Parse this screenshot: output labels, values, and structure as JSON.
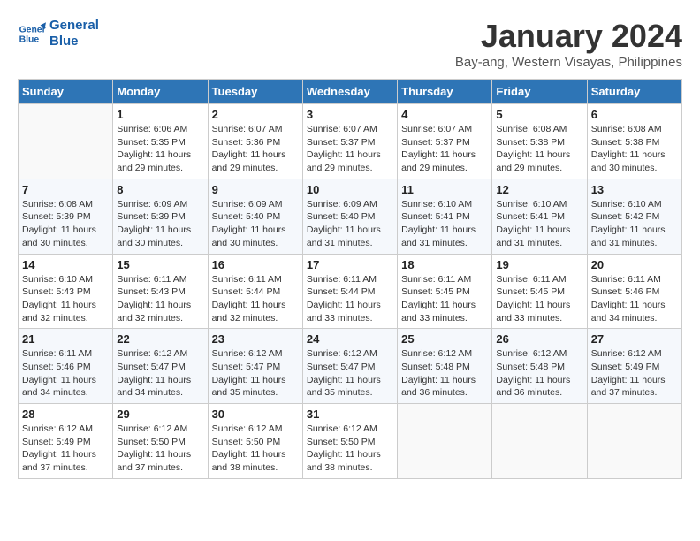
{
  "logo": {
    "line1": "General",
    "line2": "Blue"
  },
  "title": "January 2024",
  "location": "Bay-ang, Western Visayas, Philippines",
  "days_of_week": [
    "Sunday",
    "Monday",
    "Tuesday",
    "Wednesday",
    "Thursday",
    "Friday",
    "Saturday"
  ],
  "weeks": [
    [
      {
        "day": "",
        "info": ""
      },
      {
        "day": "1",
        "info": "Sunrise: 6:06 AM\nSunset: 5:35 PM\nDaylight: 11 hours\nand 29 minutes."
      },
      {
        "day": "2",
        "info": "Sunrise: 6:07 AM\nSunset: 5:36 PM\nDaylight: 11 hours\nand 29 minutes."
      },
      {
        "day": "3",
        "info": "Sunrise: 6:07 AM\nSunset: 5:37 PM\nDaylight: 11 hours\nand 29 minutes."
      },
      {
        "day": "4",
        "info": "Sunrise: 6:07 AM\nSunset: 5:37 PM\nDaylight: 11 hours\nand 29 minutes."
      },
      {
        "day": "5",
        "info": "Sunrise: 6:08 AM\nSunset: 5:38 PM\nDaylight: 11 hours\nand 29 minutes."
      },
      {
        "day": "6",
        "info": "Sunrise: 6:08 AM\nSunset: 5:38 PM\nDaylight: 11 hours\nand 30 minutes."
      }
    ],
    [
      {
        "day": "7",
        "info": "Sunrise: 6:08 AM\nSunset: 5:39 PM\nDaylight: 11 hours\nand 30 minutes."
      },
      {
        "day": "8",
        "info": "Sunrise: 6:09 AM\nSunset: 5:39 PM\nDaylight: 11 hours\nand 30 minutes."
      },
      {
        "day": "9",
        "info": "Sunrise: 6:09 AM\nSunset: 5:40 PM\nDaylight: 11 hours\nand 30 minutes."
      },
      {
        "day": "10",
        "info": "Sunrise: 6:09 AM\nSunset: 5:40 PM\nDaylight: 11 hours\nand 31 minutes."
      },
      {
        "day": "11",
        "info": "Sunrise: 6:10 AM\nSunset: 5:41 PM\nDaylight: 11 hours\nand 31 minutes."
      },
      {
        "day": "12",
        "info": "Sunrise: 6:10 AM\nSunset: 5:41 PM\nDaylight: 11 hours\nand 31 minutes."
      },
      {
        "day": "13",
        "info": "Sunrise: 6:10 AM\nSunset: 5:42 PM\nDaylight: 11 hours\nand 31 minutes."
      }
    ],
    [
      {
        "day": "14",
        "info": "Sunrise: 6:10 AM\nSunset: 5:43 PM\nDaylight: 11 hours\nand 32 minutes."
      },
      {
        "day": "15",
        "info": "Sunrise: 6:11 AM\nSunset: 5:43 PM\nDaylight: 11 hours\nand 32 minutes."
      },
      {
        "day": "16",
        "info": "Sunrise: 6:11 AM\nSunset: 5:44 PM\nDaylight: 11 hours\nand 32 minutes."
      },
      {
        "day": "17",
        "info": "Sunrise: 6:11 AM\nSunset: 5:44 PM\nDaylight: 11 hours\nand 33 minutes."
      },
      {
        "day": "18",
        "info": "Sunrise: 6:11 AM\nSunset: 5:45 PM\nDaylight: 11 hours\nand 33 minutes."
      },
      {
        "day": "19",
        "info": "Sunrise: 6:11 AM\nSunset: 5:45 PM\nDaylight: 11 hours\nand 33 minutes."
      },
      {
        "day": "20",
        "info": "Sunrise: 6:11 AM\nSunset: 5:46 PM\nDaylight: 11 hours\nand 34 minutes."
      }
    ],
    [
      {
        "day": "21",
        "info": "Sunrise: 6:11 AM\nSunset: 5:46 PM\nDaylight: 11 hours\nand 34 minutes."
      },
      {
        "day": "22",
        "info": "Sunrise: 6:12 AM\nSunset: 5:47 PM\nDaylight: 11 hours\nand 34 minutes."
      },
      {
        "day": "23",
        "info": "Sunrise: 6:12 AM\nSunset: 5:47 PM\nDaylight: 11 hours\nand 35 minutes."
      },
      {
        "day": "24",
        "info": "Sunrise: 6:12 AM\nSunset: 5:47 PM\nDaylight: 11 hours\nand 35 minutes."
      },
      {
        "day": "25",
        "info": "Sunrise: 6:12 AM\nSunset: 5:48 PM\nDaylight: 11 hours\nand 36 minutes."
      },
      {
        "day": "26",
        "info": "Sunrise: 6:12 AM\nSunset: 5:48 PM\nDaylight: 11 hours\nand 36 minutes."
      },
      {
        "day": "27",
        "info": "Sunrise: 6:12 AM\nSunset: 5:49 PM\nDaylight: 11 hours\nand 37 minutes."
      }
    ],
    [
      {
        "day": "28",
        "info": "Sunrise: 6:12 AM\nSunset: 5:49 PM\nDaylight: 11 hours\nand 37 minutes."
      },
      {
        "day": "29",
        "info": "Sunrise: 6:12 AM\nSunset: 5:50 PM\nDaylight: 11 hours\nand 37 minutes."
      },
      {
        "day": "30",
        "info": "Sunrise: 6:12 AM\nSunset: 5:50 PM\nDaylight: 11 hours\nand 38 minutes."
      },
      {
        "day": "31",
        "info": "Sunrise: 6:12 AM\nSunset: 5:50 PM\nDaylight: 11 hours\nand 38 minutes."
      },
      {
        "day": "",
        "info": ""
      },
      {
        "day": "",
        "info": ""
      },
      {
        "day": "",
        "info": ""
      }
    ]
  ]
}
